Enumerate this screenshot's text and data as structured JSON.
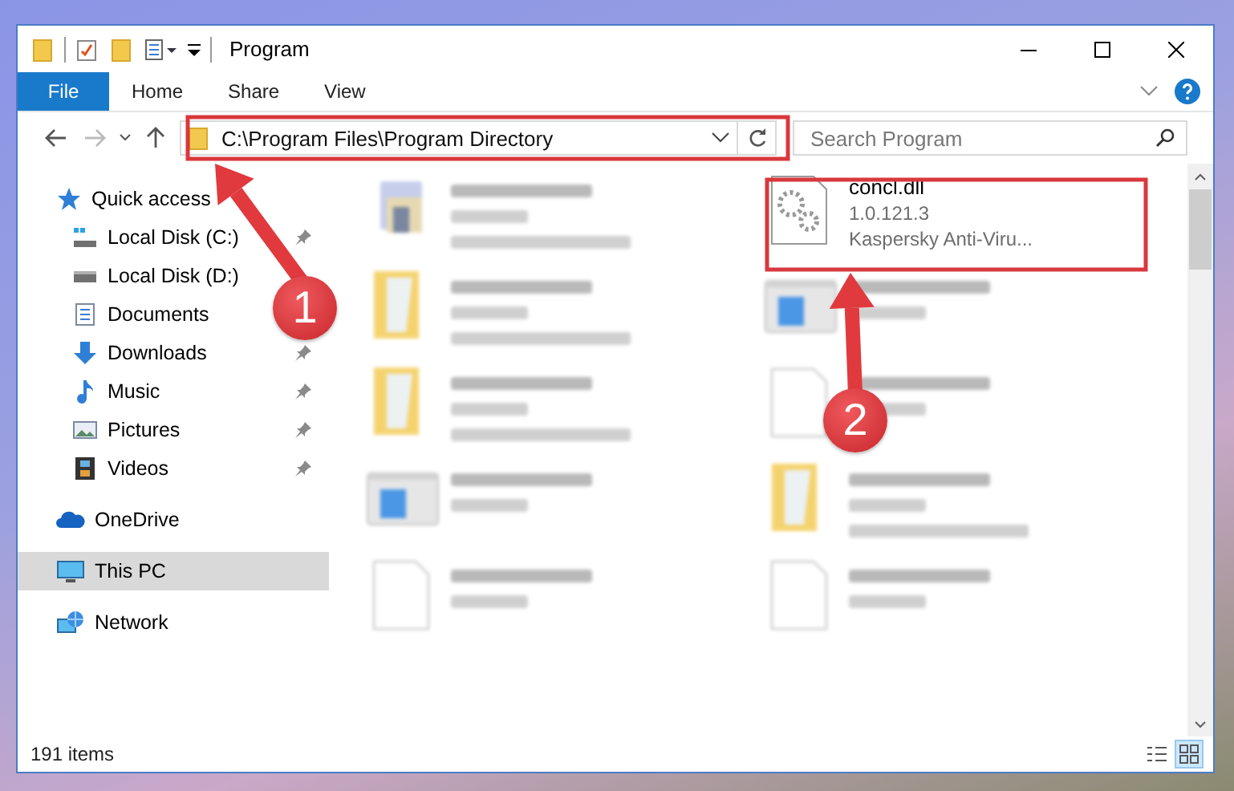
{
  "window": {
    "title": "Program"
  },
  "ribbon": {
    "tabs": [
      {
        "label": "File",
        "kind": "menu",
        "selected": false
      },
      {
        "label": "Home",
        "kind": "tab",
        "selected": false
      },
      {
        "label": "Share",
        "kind": "tab",
        "selected": false
      },
      {
        "label": "View",
        "kind": "tab",
        "selected": false
      }
    ]
  },
  "address_bar": {
    "path": "C:\\Program Files\\Program Directory"
  },
  "search": {
    "placeholder": "Search Program"
  },
  "nav_pane": {
    "items": [
      {
        "label": "Quick access",
        "kind": "star",
        "selected": false,
        "children": [
          {
            "label": "Local Disk (C:)",
            "kind": "system-drive",
            "pinned": true,
            "selected": false
          },
          {
            "label": "Local Disk (D:)",
            "kind": "drive",
            "pinned": false,
            "selected": false
          },
          {
            "label": "Documents",
            "kind": "documents",
            "pinned": false,
            "selected": false
          },
          {
            "label": "Downloads",
            "kind": "downloads",
            "pinned": true,
            "selected": false
          },
          {
            "label": "Music",
            "kind": "music",
            "pinned": true,
            "selected": false
          },
          {
            "label": "Pictures",
            "kind": "pictures",
            "pinned": true,
            "selected": false
          },
          {
            "label": "Videos",
            "kind": "videos",
            "pinned": true,
            "selected": false
          }
        ]
      },
      {
        "label": "OneDrive",
        "kind": "cloud",
        "selected": false
      },
      {
        "label": "This PC",
        "kind": "pc",
        "selected": true
      },
      {
        "label": "Network",
        "kind": "network",
        "selected": false
      }
    ]
  },
  "files": [
    {
      "kind": "app",
      "blurred": true
    },
    {
      "kind": "dll",
      "blurred": false,
      "name": "concl.dll",
      "details": [
        "1.0.121.3",
        "Kaspersky Anti-Viru..."
      ]
    },
    {
      "kind": "folder",
      "blurred": true
    },
    {
      "kind": "window",
      "blurred": true
    },
    {
      "kind": "folder",
      "blurred": true
    },
    {
      "kind": "file",
      "blurred": true
    },
    {
      "kind": "window",
      "blurred": true
    },
    {
      "kind": "folder",
      "blurred": true
    },
    {
      "kind": "file",
      "blurred": true
    },
    {
      "kind": "file",
      "blurred": true
    }
  ],
  "status_bar": {
    "item_count": "191 items",
    "views": [
      {
        "kind": "details",
        "selected": false
      },
      {
        "kind": "tiles",
        "selected": true
      }
    ]
  },
  "annotations": [
    {
      "number": "1"
    },
    {
      "number": "2"
    }
  ]
}
